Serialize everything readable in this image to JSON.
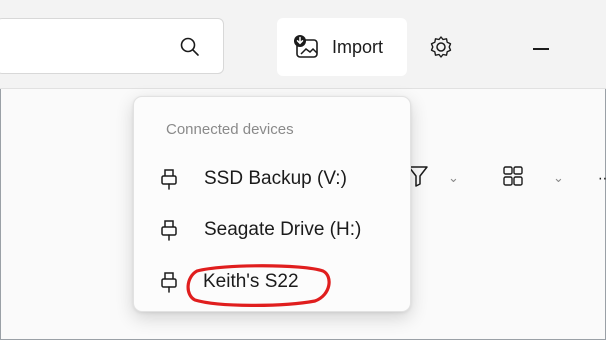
{
  "titlebar": {
    "search": {
      "placeholder": "",
      "value": ""
    },
    "import_label": "Import"
  },
  "icons": {
    "search": "search-icon",
    "import": "import-photo-icon",
    "settings": "gear-icon",
    "minimize": "minimize-icon",
    "filter": "filter-icon",
    "view": "view-layout-icon",
    "device": "usb-plug-icon"
  },
  "flyout": {
    "header": "Connected devices",
    "devices": [
      {
        "label": "SSD Backup (V:)"
      },
      {
        "label": "Seagate Drive (H:)"
      },
      {
        "label": "Keith's S22"
      }
    ]
  },
  "annotation": {
    "color": "#e01e1e"
  }
}
